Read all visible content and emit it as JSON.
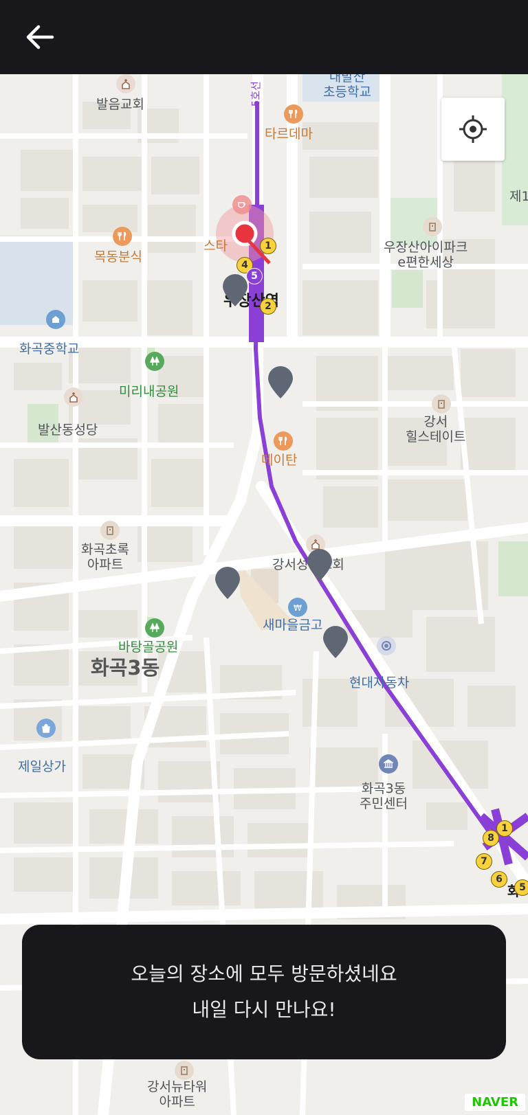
{
  "header": {
    "back_icon": "arrow-left-icon"
  },
  "map": {
    "labels": {
      "baleum_church": "발음교회",
      "elementary_school": "내발산\n초등학교",
      "tarudema": "타르데마",
      "woojangsan_apt": "우장산아이파크\ne편한세상",
      "mokdong_bunsik": "목동분식",
      "star": "스타",
      "station": "우장산역",
      "line5": "5호선",
      "hwagok_middle": "화곡중학교",
      "mirinae_park": "미리내공원",
      "balsan_cathedral": "발산동성당",
      "maytan": "메이탄",
      "gangseo_hillstate": "강서\n힐스테이트",
      "hwagok_chorok": "화곡초록\n아파트",
      "gangseo_church": "강서성결교회",
      "saemaeul_bank": "새마을금고",
      "batanggol_park": "바탕골공원",
      "hwagok3dong": "화곡3동",
      "hyundai_motors": "현대자동차",
      "jeil_sangga": "제일상가",
      "hwagok3_center": "화곡3동\n주민센터",
      "gangseo_newtower": "강서뉴타워\n아파트",
      "hwagok_edge": "화곡",
      "je1": "제1"
    },
    "exits_top": [
      "1",
      "4",
      "5",
      "2"
    ],
    "exits_bottom": [
      "1",
      "8",
      "7",
      "6",
      "5"
    ],
    "naver_logo": "NAVER"
  },
  "location_button": {
    "icon": "crosshair-icon"
  },
  "toast": {
    "line1": "오늘의 장소에 모두 방문하셨네요",
    "line2": "내일 다시 만나요!"
  },
  "colors": {
    "header_bg": "#18171c",
    "route": "#8a3fd6",
    "marker": "#606774",
    "current_location": "#e8343f"
  }
}
